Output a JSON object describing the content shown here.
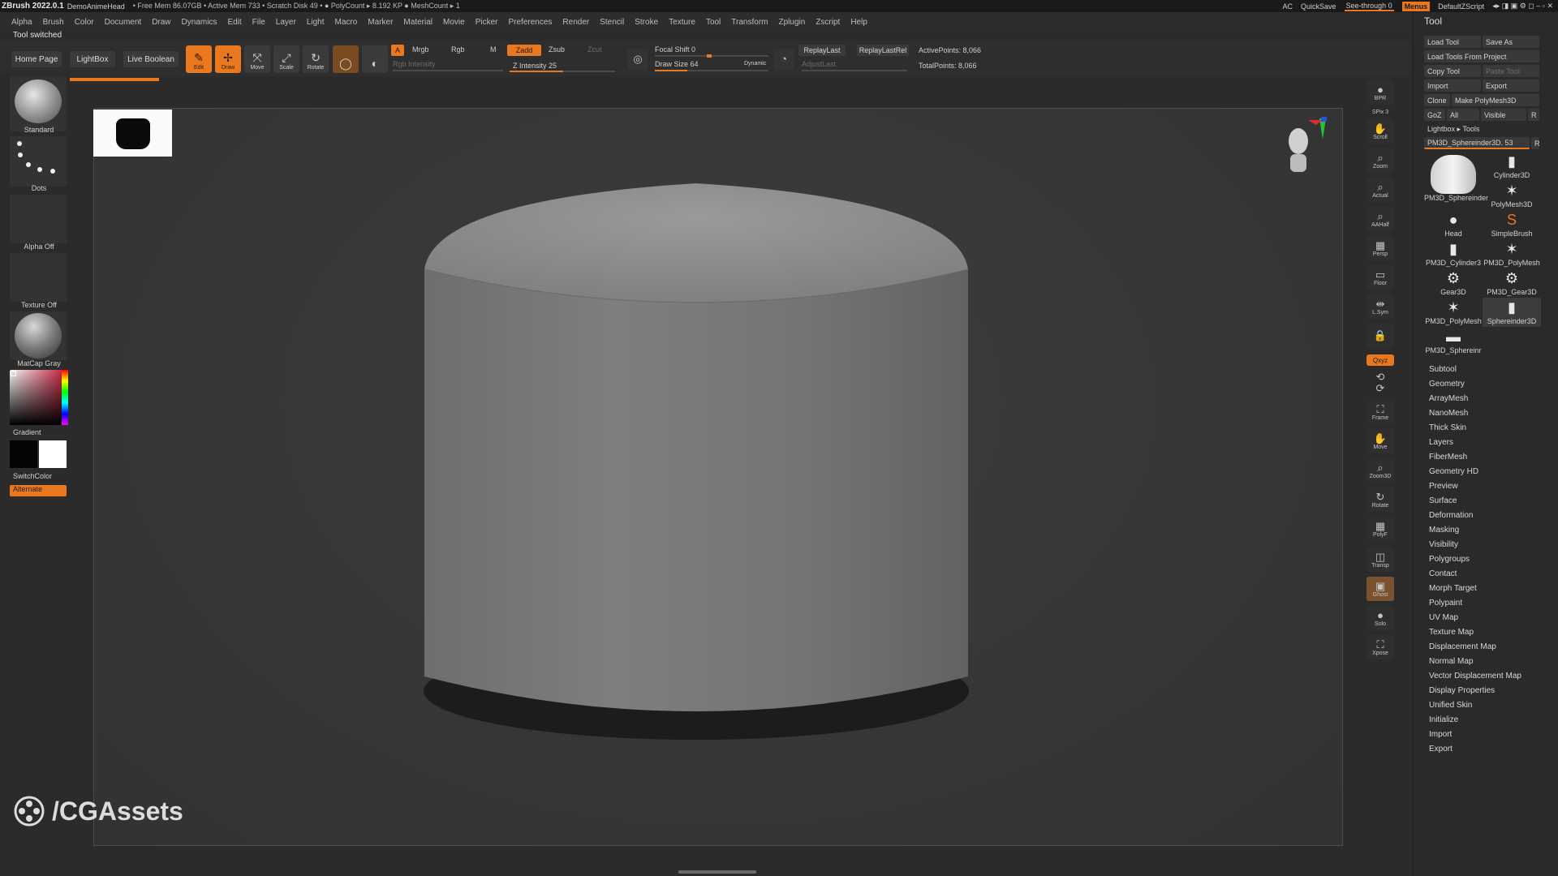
{
  "titlebar": {
    "app": "ZBrush 2022.0.1",
    "document": "DemoAnimeHead",
    "stats": "• Free Mem 86.07GB • Active Mem 733 • Scratch Disk 49 • ● PolyCount ▸ 8.192 KP ● MeshCount ▸ 1",
    "ac": "AC",
    "quicksave": "QuickSave",
    "see_through": "See-through  0",
    "menus": "Menus",
    "default_zscript": "DefaultZScript"
  },
  "menu": [
    "Alpha",
    "Brush",
    "Color",
    "Document",
    "Draw",
    "Dynamics",
    "Edit",
    "File",
    "Layer",
    "Light",
    "Macro",
    "Marker",
    "Material",
    "Movie",
    "Picker",
    "Preferences",
    "Render",
    "Stencil",
    "Stroke",
    "Texture",
    "Tool",
    "Transform",
    "Zplugin",
    "Zscript",
    "Help"
  ],
  "status_note": "Tool switched",
  "toolbar": {
    "home_page": "Home Page",
    "lightbox": "LightBox",
    "live_boolean": "Live Boolean",
    "edit": "Edit",
    "draw": "Draw",
    "move": "Move",
    "scale": "Scale",
    "rotate": "Rotate",
    "a": "A",
    "mrgb": "Mrgb",
    "rgb": "Rgb",
    "m": "M",
    "rgb_intensity": "Rgb Intensity",
    "zadd": "Zadd",
    "zsub": "Zsub",
    "zcut": "Zcut",
    "z_intensity": "Z Intensity 25",
    "focal_shift": "Focal Shift 0",
    "draw_size": "Draw Size 64",
    "dynamic": "Dynamic",
    "replay_last": "ReplayLast",
    "replay_last_rel": "ReplayLastRel",
    "adjust_last": "AdjustLast",
    "active_points": "ActivePoints: 8,066",
    "total_points": "TotalPoints: 8,066"
  },
  "left_shelf": {
    "standard": "Standard",
    "dots": "Dots",
    "alpha_off": "Alpha Off",
    "texture_off": "Texture Off",
    "matcap": "MatCap Gray",
    "gradient": "Gradient",
    "switch_color": "SwitchColor",
    "alternate": "Alternate"
  },
  "right_icons": [
    {
      "name": "bpr",
      "label": "BPR"
    },
    {
      "name": "spix",
      "label": "SPix 3"
    },
    {
      "name": "scroll",
      "label": "Scroll"
    },
    {
      "name": "zoom",
      "label": "Zoom"
    },
    {
      "name": "actual",
      "label": "Actual"
    },
    {
      "name": "aahalf",
      "label": "AAHalf"
    },
    {
      "name": "persp",
      "label": "Persp"
    },
    {
      "name": "floor",
      "label": "Floor"
    },
    {
      "name": "lsym",
      "label": "L.Sym"
    },
    {
      "name": "lock",
      "label": ""
    },
    {
      "name": "xyz",
      "label": "Qxyz"
    },
    {
      "name": "frame",
      "label": "Frame"
    },
    {
      "name": "move",
      "label": "Move"
    },
    {
      "name": "zoom3d",
      "label": "Zoom3D"
    },
    {
      "name": "rotate",
      "label": "Rotate"
    },
    {
      "name": "polyf",
      "label": "PolyF"
    },
    {
      "name": "transp",
      "label": "Transp"
    },
    {
      "name": "ghost",
      "label": "Ghost"
    },
    {
      "name": "solo",
      "label": "Solo"
    },
    {
      "name": "xpose",
      "label": "Xpose"
    }
  ],
  "palette": {
    "title": "Tool",
    "load_tool": "Load Tool",
    "save_as": "Save As",
    "load_from_project": "Load Tools From Project",
    "copy_tool": "Copy Tool",
    "paste_tool": "Paste Tool",
    "import": "Import",
    "export": "Export",
    "clone": "Clone",
    "make_polymesh": "Make PolyMesh3D",
    "goz": "GoZ",
    "all": "All",
    "visible": "Visible",
    "r": "R",
    "lightbox_tools": "Lightbox ▸ Tools",
    "current_tool": "PM3D_Sphereinder3D. 53",
    "tools": [
      {
        "label": "PM3D_Sphereinder",
        "icon": "cylinder-icon"
      },
      {
        "label": "Cylinder3D",
        "icon": "cylinder-icon"
      },
      {
        "label": "PolyMesh3D",
        "icon": "star-icon"
      },
      {
        "label": "Head",
        "icon": "head-icon"
      },
      {
        "label": "SimpleBrush",
        "icon": "s-brush-icon"
      },
      {
        "label": "PM3D_Cylinder3",
        "icon": "cylinder-icon"
      },
      {
        "label": "PM3D_PolyMesh",
        "icon": "star-icon"
      },
      {
        "label": "Gear3D",
        "icon": "gear-icon"
      },
      {
        "label": "PM3D_Gear3D",
        "icon": "gear-icon"
      },
      {
        "label": "PM3D_PolyMesh",
        "icon": "star-icon"
      },
      {
        "label": "Sphereinder3D",
        "icon": "cylinder-icon"
      },
      {
        "label": "PM3D_Sphereinr",
        "icon": "cylinder-icon"
      }
    ],
    "sections": [
      "Subtool",
      "Geometry",
      "ArrayMesh",
      "NanoMesh",
      "Thick Skin",
      "Layers",
      "FiberMesh",
      "Geometry HD",
      "Preview",
      "Surface",
      "Deformation",
      "Masking",
      "Visibility",
      "Polygroups",
      "Contact",
      "Morph Target",
      "Polypaint",
      "UV Map",
      "Texture Map",
      "Displacement Map",
      "Normal Map",
      "Vector Displacement Map",
      "Display Properties",
      "Unified Skin",
      "Initialize",
      "Import",
      "Export"
    ]
  },
  "watermark": "/CGAssets",
  "colors": {
    "accent": "#e9781f",
    "panel": "#2b2b2b",
    "viewport": "#3a3a3a"
  }
}
